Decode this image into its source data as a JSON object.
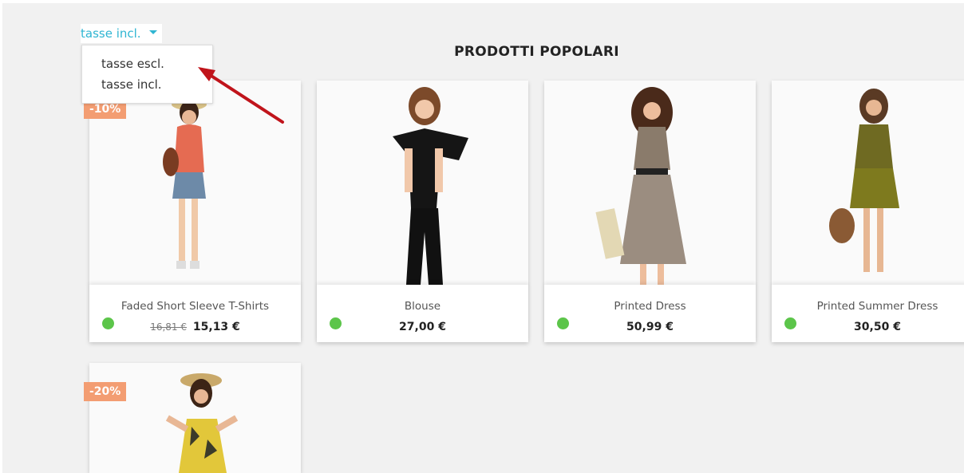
{
  "currency_selector": {
    "current": "tasse incl.",
    "options": [
      "tasse escl.",
      "tasse incl."
    ]
  },
  "section": {
    "title": "PRODOTTI POPOLARI"
  },
  "products": [
    {
      "name": "Faded Short Sleeve T-Shirts",
      "old_price": "16,81 €",
      "price": "15,13 €",
      "badge": "-10%",
      "available": true
    },
    {
      "name": "Blouse",
      "price": "27,00 €",
      "available": true
    },
    {
      "name": "Printed Dress",
      "price": "50,99 €",
      "available": true
    },
    {
      "name": "Printed Summer Dress",
      "price": "30,50 €",
      "available": true
    },
    {
      "badge": "-20%"
    }
  ],
  "colors": {
    "accent": "#2fb5d2",
    "badge": "#f39d72",
    "in_stock": "#5cc54a",
    "arrow": "#c0141b"
  }
}
